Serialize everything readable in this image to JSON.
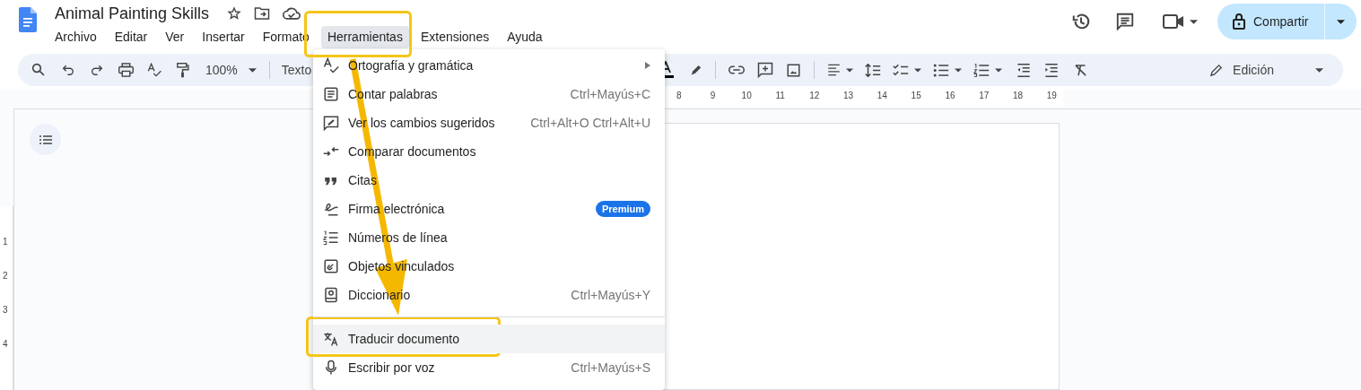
{
  "document": {
    "title": "Animal Painting Skills"
  },
  "menubar": [
    {
      "label": "Archivo",
      "selected": false
    },
    {
      "label": "Editar",
      "selected": false
    },
    {
      "label": "Ver",
      "selected": false
    },
    {
      "label": "Insertar",
      "selected": false
    },
    {
      "label": "Formato",
      "selected": false
    },
    {
      "label": "Herramientas",
      "selected": true
    },
    {
      "label": "Extensiones",
      "selected": false
    },
    {
      "label": "Ayuda",
      "selected": false
    }
  ],
  "share_button": {
    "label": "Compartir"
  },
  "toolbar": {
    "zoom": "100%",
    "style": "Texto",
    "mode": "Edición"
  },
  "ruler": {
    "horizontal": [
      "8",
      "9",
      "10",
      "11",
      "12",
      "13",
      "14",
      "15",
      "16",
      "17",
      "18",
      "19"
    ],
    "vertical": [
      "1",
      "2",
      "3",
      "4"
    ]
  },
  "tools_menu": {
    "groups": [
      [
        {
          "label": "Ortografía y gramática",
          "kind": "submenu",
          "highlighted": false
        },
        {
          "label": "Contar palabras",
          "kind": "shortcut",
          "shortcut": "Ctrl+Mayús+C",
          "highlighted": false
        },
        {
          "label": "Ver los cambios sugeridos",
          "kind": "shortcut",
          "shortcut": "Ctrl+Alt+O Ctrl+Alt+U",
          "highlighted": false
        },
        {
          "label": "Comparar documentos",
          "kind": "plain",
          "highlighted": false
        },
        {
          "label": "Citas",
          "kind": "plain",
          "highlighted": false
        },
        {
          "label": "Firma electrónica",
          "kind": "badge",
          "badge": "Premium",
          "highlighted": false
        },
        {
          "label": "Números de línea",
          "kind": "plain",
          "highlighted": false
        },
        {
          "label": "Objetos vinculados",
          "kind": "plain",
          "highlighted": false
        },
        {
          "label": "Diccionario",
          "kind": "shortcut",
          "shortcut": "Ctrl+Mayús+Y",
          "highlighted": false
        }
      ],
      [
        {
          "label": "Traducir documento",
          "kind": "plain",
          "highlighted": true
        },
        {
          "label": "Escribir por voz",
          "kind": "shortcut",
          "shortcut": "Ctrl+Mayús+S",
          "highlighted": false
        }
      ]
    ]
  }
}
